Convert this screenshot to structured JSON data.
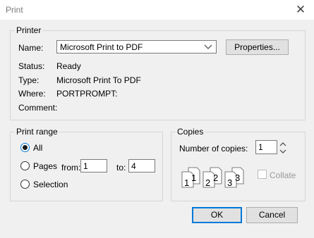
{
  "window": {
    "title": "Print",
    "close_glyph": "✕"
  },
  "printer": {
    "legend": "Printer",
    "name_label": "Name:",
    "name_value": "Microsoft Print to PDF",
    "properties_button": "Properties...",
    "status_label": "Status:",
    "status_value": "Ready",
    "type_label": "Type:",
    "type_value": "Microsoft Print To PDF",
    "where_label": "Where:",
    "where_value": "PORTPROMPT:",
    "comment_label": "Comment:",
    "comment_value": ""
  },
  "print_range": {
    "legend": "Print range",
    "all_label": "All",
    "pages_label": "Pages",
    "from_label": "from:",
    "from_value": "1",
    "to_label": "to:",
    "to_value": "4",
    "selection_label": "Selection",
    "selected": "all"
  },
  "copies": {
    "legend": "Copies",
    "number_label": "Number of copies:",
    "number_value": "1",
    "collate_label": "Collate",
    "collate_checked": false,
    "collate_pages": [
      "1",
      "1",
      "2",
      "2",
      "3",
      "3"
    ]
  },
  "buttons": {
    "ok": "OK",
    "cancel": "Cancel"
  },
  "colors": {
    "accent": "#0078d7",
    "dialog_bg": "#f0f0f0",
    "button_bg": "#e1e1e1"
  },
  "icons": {
    "close": "close-icon",
    "dropdown": "chevron-down-icon",
    "spin": "spin-arrows-icon",
    "collate": "collate-pages-icon"
  }
}
